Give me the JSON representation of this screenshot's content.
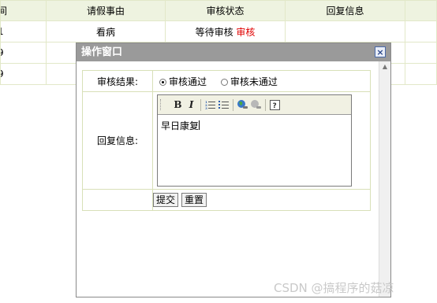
{
  "table": {
    "headers": [
      "间",
      "请假事由",
      "审核状态",
      "回复信息"
    ],
    "rows": [
      {
        "id_fragment": "1",
        "reason": "看病",
        "status": "等待审核",
        "action": "审核",
        "reply": ""
      },
      {
        "id_fragment": "9",
        "reason": "",
        "status": "",
        "action": "",
        "reply": ""
      },
      {
        "id_fragment": "9",
        "reason": "",
        "status": "",
        "action": "",
        "reply": ""
      }
    ]
  },
  "dialog": {
    "title": "操作窗口",
    "close_symbol": "×",
    "result_label": "审核结果:",
    "options": [
      "审核通过",
      "审核未通过"
    ],
    "selected_option": "审核通过",
    "reply_label": "回复信息:",
    "reply_text": "早日康复",
    "toolbar": {
      "bold": "B",
      "italic": "I",
      "ordered_list": "ordered-list-icon",
      "unordered_list": "unordered-list-icon",
      "link": "globe-link-icon",
      "unlink": "unlink-icon",
      "help": "help-icon"
    },
    "submit_label": "提交",
    "reset_label": "重置"
  },
  "watermark": "CSDN @搞程序的菇凉",
  "colors": {
    "action_red": "#e00000",
    "title_bar": "#9a9a9a",
    "header_bg": "#eef3e0",
    "border": "#e2e8c8"
  }
}
